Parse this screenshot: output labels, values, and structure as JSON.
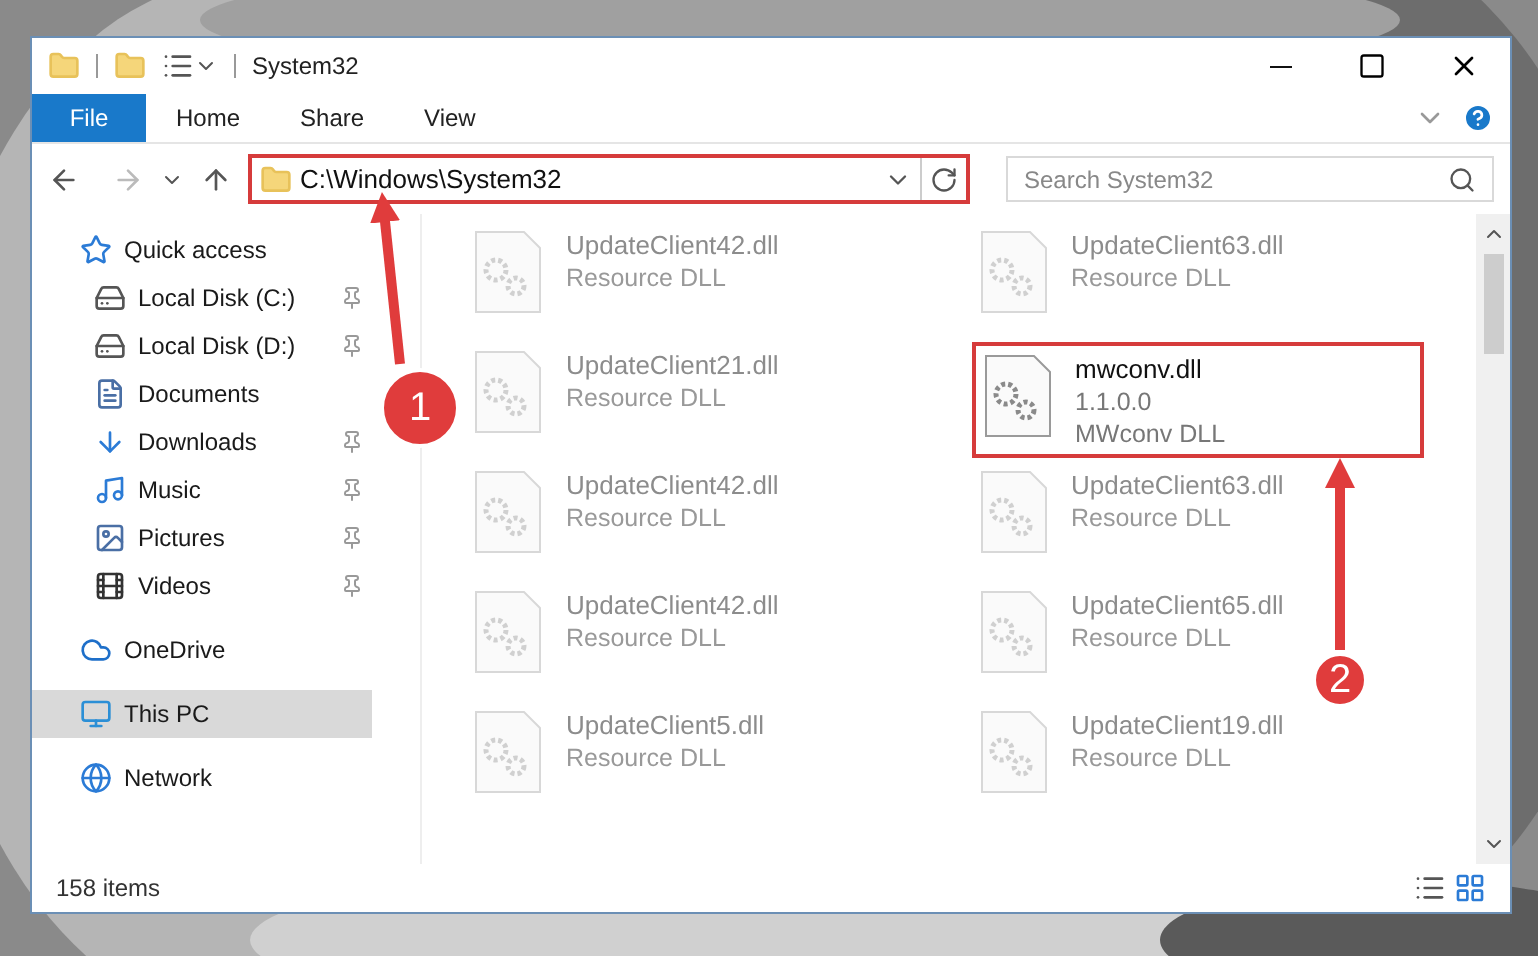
{
  "window": {
    "title": "System32"
  },
  "ribbon_tabs": [
    {
      "label": "File",
      "kind": "file"
    },
    {
      "label": "Home",
      "kind": "tab"
    },
    {
      "label": "Share",
      "kind": "tab"
    },
    {
      "label": "View",
      "kind": "tab"
    }
  ],
  "address_bar": {
    "path": "C:\\Windows\\System32",
    "highlighted": true
  },
  "search": {
    "placeholder": "Search System32"
  },
  "sidebar": {
    "items": [
      {
        "label": "Quick access",
        "kind": "star",
        "selected": false,
        "children": [
          {
            "label": "Local Disk (C:)",
            "kind": "disk",
            "pinned": true,
            "selected": false
          },
          {
            "label": "Local Disk (D:)",
            "kind": "disk",
            "pinned": true,
            "selected": false
          },
          {
            "label": "Documents",
            "kind": "doc",
            "pinned": false,
            "selected": false
          },
          {
            "label": "Downloads",
            "kind": "download",
            "pinned": true,
            "selected": false
          },
          {
            "label": "Music",
            "kind": "music",
            "pinned": true,
            "selected": false
          },
          {
            "label": "Pictures",
            "kind": "pictures",
            "pinned": true,
            "selected": false
          },
          {
            "label": "Videos",
            "kind": "videos",
            "pinned": true,
            "selected": false
          }
        ]
      },
      {
        "label": "OneDrive",
        "kind": "cloud",
        "selected": false
      },
      {
        "label": "This PC",
        "kind": "pc",
        "selected": true
      },
      {
        "label": "Network",
        "kind": "network",
        "selected": false
      }
    ]
  },
  "files": [
    {
      "name": "UpdateClient42.dll",
      "lines": [
        "Resource DLL"
      ],
      "faded": true,
      "highlighted": false
    },
    {
      "name": "UpdateClient63.dll",
      "lines": [
        "Resource DLL"
      ],
      "faded": true,
      "highlighted": false
    },
    {
      "name": "UpdateClient21.dll",
      "lines": [
        "Resource DLL"
      ],
      "faded": true,
      "highlighted": false
    },
    {
      "name": "mwconv.dll",
      "lines": [
        "1.1.0.0",
        "MWconv DLL"
      ],
      "faded": false,
      "highlighted": true
    },
    {
      "name": "UpdateClient42.dll",
      "lines": [
        "Resource DLL"
      ],
      "faded": true,
      "highlighted": false
    },
    {
      "name": "UpdateClient63.dll",
      "lines": [
        "Resource DLL"
      ],
      "faded": true,
      "highlighted": false
    },
    {
      "name": "UpdateClient42.dll",
      "lines": [
        "Resource DLL"
      ],
      "faded": true,
      "highlighted": false
    },
    {
      "name": "UpdateClient65.dll",
      "lines": [
        "Resource DLL"
      ],
      "faded": true,
      "highlighted": false
    },
    {
      "name": "UpdateClient5.dll",
      "lines": [
        "Resource DLL"
      ],
      "faded": true,
      "highlighted": false
    },
    {
      "name": "UpdateClient19.dll",
      "lines": [
        "Resource DLL"
      ],
      "faded": true,
      "highlighted": false
    }
  ],
  "status_bar": {
    "count": "158 items"
  },
  "annotations": [
    {
      "number": "1"
    },
    {
      "number": "2"
    }
  ]
}
